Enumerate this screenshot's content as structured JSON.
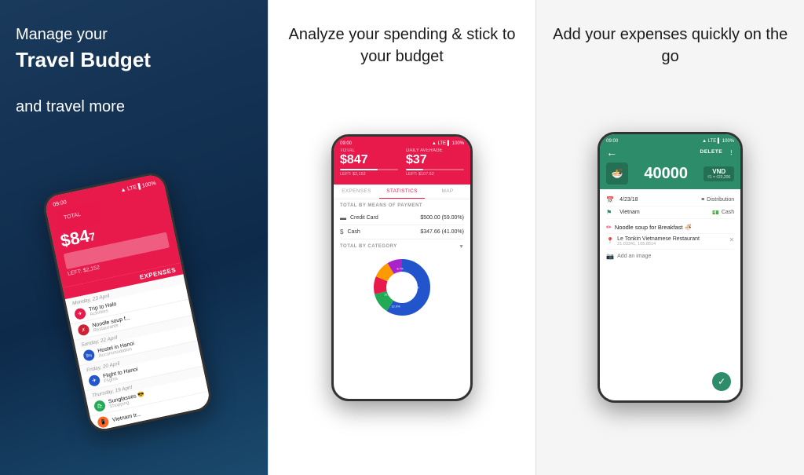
{
  "panels": {
    "left": {
      "headline_line1": "Manage your",
      "headline_bold": "Travel Budget",
      "headline_line3": "and travel more",
      "phone": {
        "status_time": "09:00",
        "total_label": "TOTAL",
        "total_amount": "$84",
        "left_amount": "LEFT: $2,152",
        "expenses_header": "EXPENSES",
        "dates": [
          "Monday, 23 April",
          "Sunday, 22 April",
          "Friday, 20 April",
          "Thursday, 19 April"
        ],
        "items": [
          {
            "name": "Trip to Halo",
            "category": "Activities",
            "icon": "✈",
            "color": "pink"
          },
          {
            "name": "Noodle soup f...",
            "category": "Restaurants",
            "icon": "✗",
            "color": "red"
          },
          {
            "name": "Hostel in Hanoi",
            "category": "Accommodation",
            "icon": "🛏",
            "color": "blue"
          },
          {
            "name": "Flight to Hanoi",
            "category": "Flights",
            "icon": "✈",
            "color": "blue"
          },
          {
            "name": "Sunglasses 😎",
            "category": "Shopping",
            "icon": "🛍",
            "color": "green"
          },
          {
            "name": "Vietnam tr...",
            "category": "",
            "icon": "📱",
            "color": "orange"
          }
        ]
      }
    },
    "middle": {
      "headline": "Analyze your spending & stick to your budget",
      "phone": {
        "status_time": "09:00",
        "total_label": "TOTAL",
        "total_amount": "$847",
        "daily_label": "DAILY AVERAGE",
        "daily_amount": "$37",
        "total_left": "LEFT: $2,152",
        "daily_left": "LEFT: $107.62",
        "tabs": [
          "EXPENSES",
          "STATISTICS",
          "MAP"
        ],
        "active_tab": "STATISTICS",
        "section_title": "TOTAL BY MEANS OF PAYMENT",
        "payments": [
          {
            "icon": "💳",
            "name": "Credit Card",
            "amount": "$500.00 (59.00%)"
          },
          {
            "icon": "$",
            "name": "Cash",
            "amount": "$347.66 (41.00%)"
          }
        ],
        "category_section": "TOTAL BY CATEGORY",
        "chart": {
          "segments": [
            {
              "label": "59.0%",
              "color": "#2255cc",
              "value": 59
            },
            {
              "label": "12.0%",
              "color": "#22aa55",
              "value": 12
            },
            {
              "label": "10.2%",
              "color": "#e8194b",
              "value": 10.2
            },
            {
              "label": "10.1%",
              "color": "#ff6622",
              "value": 10.1
            },
            {
              "label": "8.7%",
              "color": "#aa22cc",
              "value": 8.7
            }
          ]
        }
      }
    },
    "right": {
      "headline": "Add your expenses quickly on the go",
      "phone": {
        "status_time": "09:00",
        "nav_back": "←",
        "nav_delete": "DELETE",
        "nav_more": "⋮",
        "amount": "40000",
        "currency_code": "VND",
        "currency_sub": "₫1 = ₫23,206",
        "category_icon": "🍜",
        "details": [
          {
            "icon": "📅",
            "label": "4/23/18",
            "value_icon": "≡",
            "value": "Distribution"
          },
          {
            "icon": "🏳",
            "label": "Vietnam",
            "value_icon": "💵",
            "value": "Cash"
          }
        ],
        "description": "Noodle soup for Breakfast 🍜",
        "location_name": "Le Tonkin Vietnamese Restaurant",
        "location_coords": "21.03341, 105.8514",
        "add_image": "Add an image",
        "save_icon": "✓"
      }
    }
  }
}
